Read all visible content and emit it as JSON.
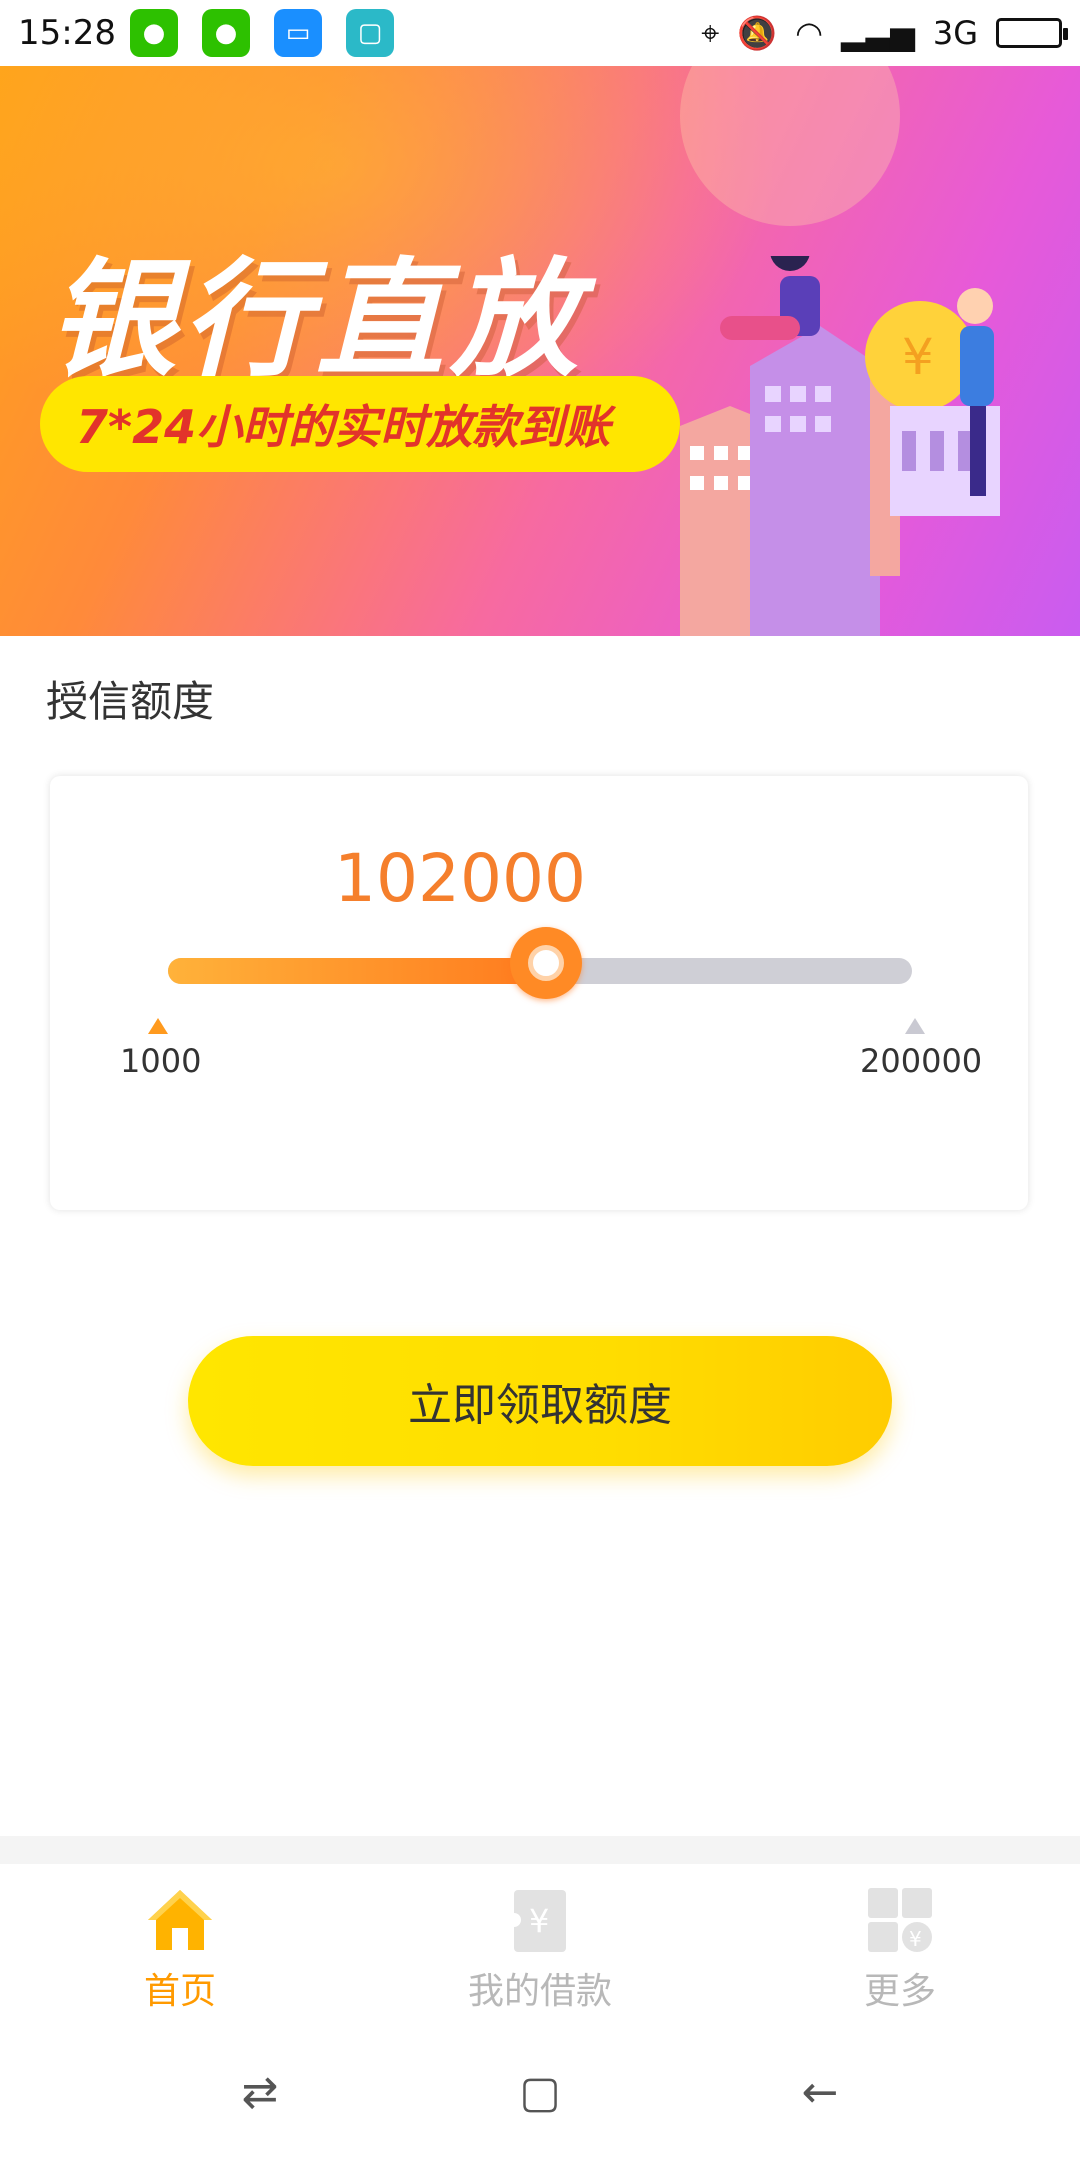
{
  "status_bar": {
    "time": "15:28",
    "network": "3G"
  },
  "banner": {
    "title": "银行直放",
    "subtitle": "7*24小时的实时放款到账"
  },
  "section_title": "授信额度",
  "slider": {
    "value_text": "102000",
    "min_label": "1000",
    "max_label": "200000",
    "value": 102000,
    "min": 1000,
    "max": 200000
  },
  "cta_label": "立即领取额度",
  "bottom_nav": {
    "home": "首页",
    "loans": "我的借款",
    "more": "更多"
  },
  "colors": {
    "accent": "#ff9a00",
    "amount": "#f57f2c",
    "cta": "#ffe600"
  }
}
